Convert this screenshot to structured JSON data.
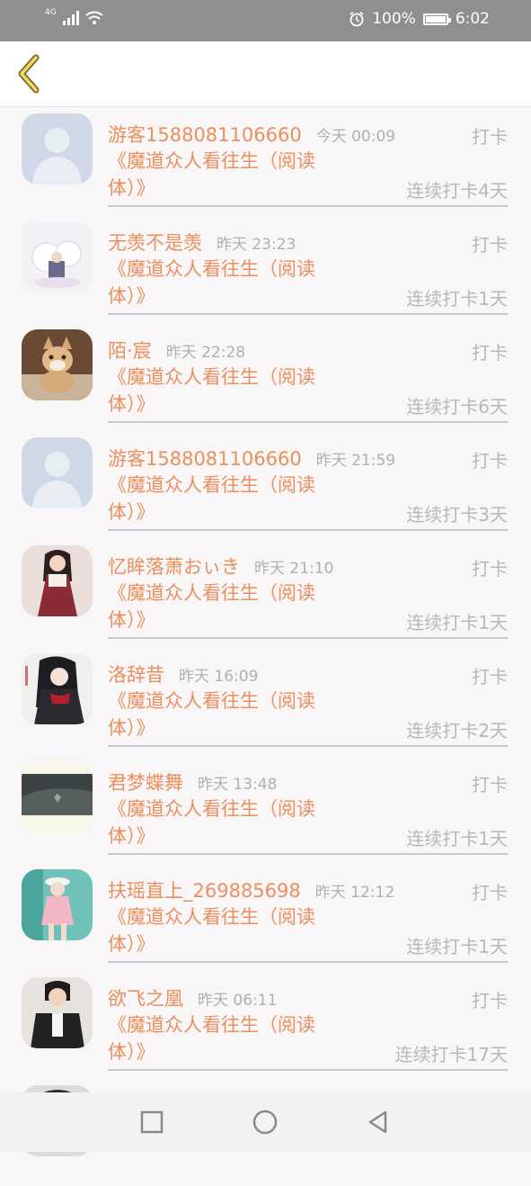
{
  "status_bar": {
    "network_label": "4G",
    "battery": "100%",
    "time": "6:02"
  },
  "checkins": [
    {
      "name": "游客1588081106660",
      "time": "今天 00:09",
      "action": "打卡",
      "book": "《魔道众人看往生（阅读体）》",
      "streak": "连续打卡4天",
      "avatar": "default-avatar"
    },
    {
      "name": "无羡不是羡",
      "time": "昨天 23:23",
      "action": "打卡",
      "book": "《魔道众人看往生（阅读体）》",
      "streak": "连续打卡1天",
      "avatar": "illustration-avatar"
    },
    {
      "name": "陌·宸",
      "time": "昨天 22:28",
      "action": "打卡",
      "book": "《魔道众人看往生（阅读体）》",
      "streak": "连续打卡6天",
      "avatar": "cat-avatar"
    },
    {
      "name": "游客1588081106660",
      "time": "昨天 21:59",
      "action": "打卡",
      "book": "《魔道众人看往生（阅读体）》",
      "streak": "连续打卡3天",
      "avatar": "default-avatar"
    },
    {
      "name": "忆眸落萧おぃき",
      "time": "昨天 21:10",
      "action": "打卡",
      "book": "《魔道众人看往生（阅读体）》",
      "streak": "连续打卡1天",
      "avatar": "girl-avatar"
    },
    {
      "name": "洛辞昔",
      "time": "昨天 16:09",
      "action": "打卡",
      "book": "《魔道众人看往生（阅读体）》",
      "streak": "连续打卡2天",
      "avatar": "anime-avatar"
    },
    {
      "name": "君梦蝶舞",
      "time": "昨天 13:48",
      "action": "打卡",
      "book": "《魔道众人看往生（阅读体）》",
      "streak": "连续打卡1天",
      "avatar": "dark-avatar"
    },
    {
      "name": "扶瑶直上_269885698",
      "time": "昨天 12:12",
      "action": "打卡",
      "book": "《魔道众人看往生（阅读体）》",
      "streak": "连续打卡1天",
      "avatar": "photo-avatar"
    },
    {
      "name": "欲飞之凰",
      "time": "昨天 06:11",
      "action": "打卡",
      "book": "《魔道众人看往生（阅读体）》",
      "streak": "连续打卡17天",
      "avatar": "boy-avatar"
    }
  ],
  "colors": {
    "accent": "#ec8f5e",
    "muted": "#b8b8b8",
    "background": "#f8f6f7"
  }
}
